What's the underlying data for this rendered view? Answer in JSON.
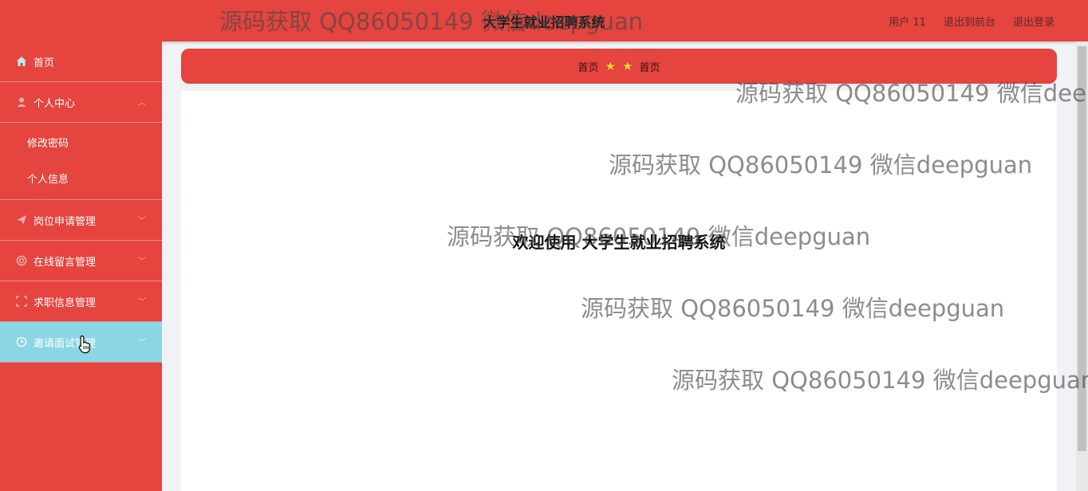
{
  "header": {
    "title": "大学生就业招聘系统",
    "user_label": "用户 11",
    "back_to_front": "退出到前台",
    "logout": "退出登录"
  },
  "sidebar": {
    "items": [
      {
        "label": "首页",
        "icon": "home-icon"
      },
      {
        "label": "个人中心",
        "icon": "user-icon",
        "children": [
          "修改密码",
          "个人信息"
        ]
      },
      {
        "label": "岗位申请管理",
        "icon": "send-icon"
      },
      {
        "label": "在线留言管理",
        "icon": "message-icon"
      },
      {
        "label": "求职信息管理",
        "icon": "frame-icon"
      },
      {
        "label": "邀请面试管理",
        "icon": "clock-icon"
      }
    ],
    "active_index": 5
  },
  "breadcrumb": {
    "home": "首页",
    "current": "首页"
  },
  "main": {
    "welcome": "欢迎使用 大学生就业招聘系统"
  },
  "watermark": {
    "text": "源码获取 QQ86050149 微信deepguan"
  },
  "colors": {
    "primary": "#e5443f",
    "active_menu": "#8ad6e4",
    "star": "#ffd23a"
  }
}
